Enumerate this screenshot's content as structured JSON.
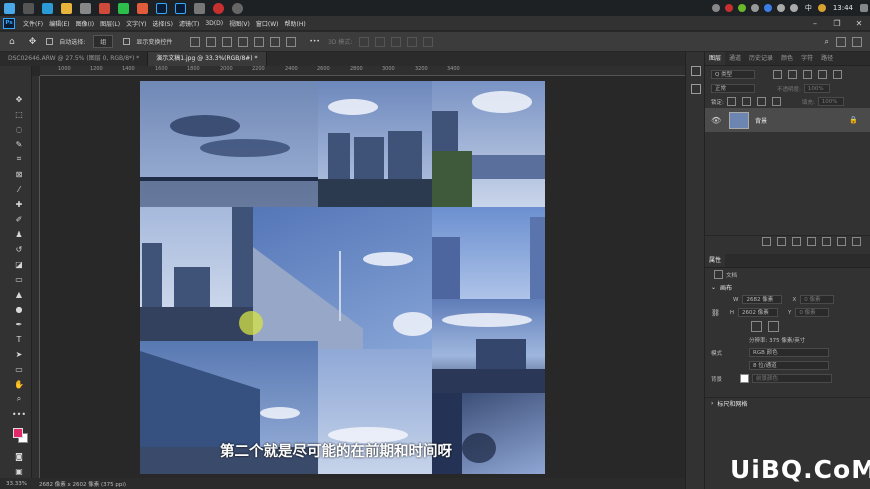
{
  "taskbar": {
    "clock": "13:44",
    "ime": "中",
    "colors": {
      "bg": "#1e2124"
    }
  },
  "menubar": {
    "items": [
      "文件(F)",
      "编辑(E)",
      "图像(I)",
      "图层(L)",
      "文字(Y)",
      "选择(S)",
      "滤镜(T)",
      "3D(D)",
      "视图(V)",
      "窗口(W)",
      "帮助(H)"
    ],
    "logo": "Ps"
  },
  "optionsbar": {
    "auto_select": "自动选择:",
    "layer_select": "组",
    "show_transform": "显示变换控件",
    "mode_3d": "3D 模式:"
  },
  "doctabs": [
    {
      "label": "DSC02646.ARW @ 27.5% (图层 0, RGB/8*) *",
      "active": false
    },
    {
      "label": "演示文稿1.jpg @ 33.3%(RGB/8#) *",
      "active": true
    }
  ],
  "ruler": {
    "ticks": [
      "1000",
      "1200",
      "1400",
      "1600",
      "1800",
      "2000",
      "2200",
      "2400",
      "2600",
      "2800",
      "3000",
      "3200",
      "3400"
    ]
  },
  "canvas": {
    "subtitle": "第二个就是尽可能的在前期和时间呀",
    "accent": "#e0286b"
  },
  "statusbar": {
    "zoom": "33.33%",
    "size": "2682 像素 x 2602 像素 (375 ppi)"
  },
  "layers_panel": {
    "tabs": [
      "图层",
      "通道",
      "历史记录",
      "颜色",
      "字符",
      "路径"
    ],
    "search_placeholder": "Q 类型",
    "blend_mode": "正常",
    "opacity_label": "不透明度:",
    "opacity_value": "100%",
    "lock_label": "锁定:",
    "fill_label": "填充:",
    "fill_value": "100%",
    "layer_name": "背景"
  },
  "properties_panel": {
    "title": "属性",
    "doc_label": "文档",
    "canvas_section": "画布",
    "w_label": "W",
    "w_value": "2682 像素",
    "x_label": "X",
    "x_value": "0 像素",
    "h_label": "H",
    "h_value": "2602 像素",
    "y_label": "Y",
    "y_value": "0 像素",
    "resolution": "分辨率: 375 像素/英寸",
    "mode_label": "模式",
    "mode_value": "RGB 颜色",
    "depth_value": "8 位/通道",
    "bg_label": "背景",
    "bg_value": "前景颜色",
    "rulers_section": "标尺和网格"
  },
  "watermark": "UiBQ.CoM"
}
